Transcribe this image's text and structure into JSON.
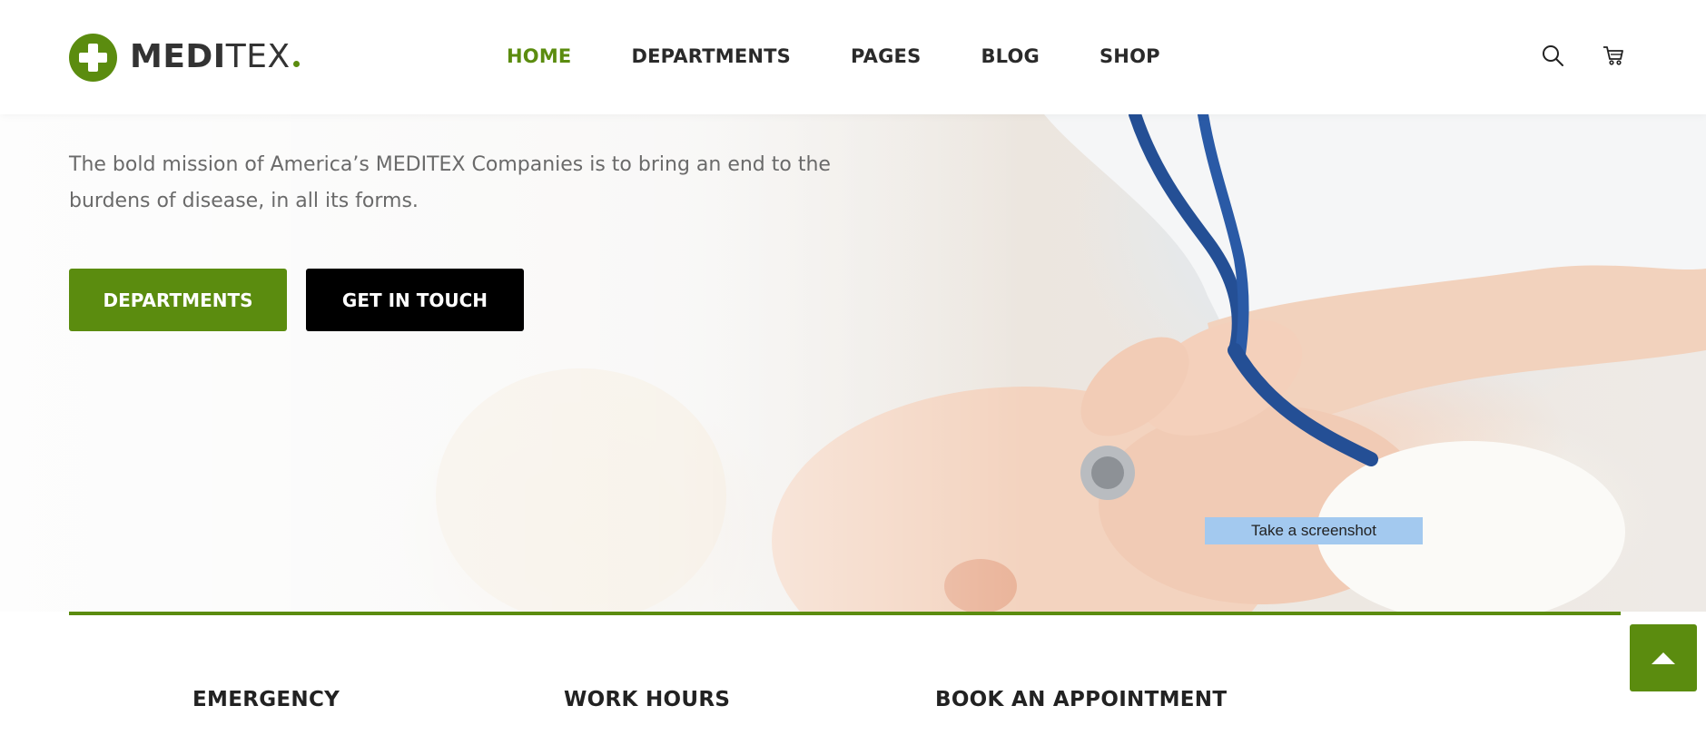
{
  "brand": {
    "name_bold": "MEDI",
    "name_light": "TEX",
    "accent_color": "#5b8c0f",
    "logo_icon": "medical-cross-icon"
  },
  "nav": {
    "items": [
      {
        "label": "HOME",
        "active": true
      },
      {
        "label": "DEPARTMENTS",
        "active": false
      },
      {
        "label": "PAGES",
        "active": false
      },
      {
        "label": "BLOG",
        "active": false
      },
      {
        "label": "SHOP",
        "active": false
      }
    ]
  },
  "header_icons": {
    "search": "search-icon",
    "cart": "cart-icon"
  },
  "hero": {
    "text": "The bold mission of America’s MEDITEX Companies is to bring an end to the burdens of disease, in all its forms.",
    "primary_button": "DEPARTMENTS",
    "secondary_button": "GET IN TOUCH"
  },
  "tooltip": {
    "text": "Take a screenshot"
  },
  "info": {
    "titles": [
      "EMERGENCY",
      "WORK HOURS",
      "BOOK AN APPOINTMENT"
    ]
  },
  "scroll_top": {
    "icon": "arrow-up-icon"
  }
}
